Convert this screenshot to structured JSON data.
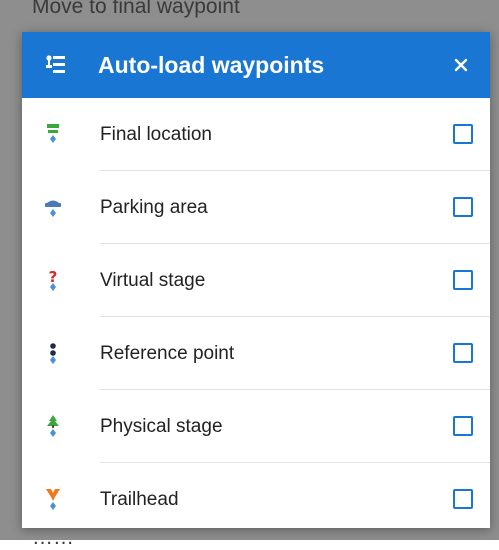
{
  "background": {
    "top_text": "Move to final waypoint",
    "bottom_text": "……"
  },
  "dialog": {
    "title": "Auto-load waypoints",
    "header_icon": "waypoint-list-icon",
    "close_icon": "close-icon",
    "accent_color": "#1976d2",
    "items": [
      {
        "label": "Final location",
        "icon": "final-location-icon",
        "checked": false
      },
      {
        "label": "Parking area",
        "icon": "parking-area-icon",
        "checked": false
      },
      {
        "label": "Virtual stage",
        "icon": "virtual-stage-icon",
        "checked": false
      },
      {
        "label": "Reference point",
        "icon": "reference-point-icon",
        "checked": false
      },
      {
        "label": "Physical stage",
        "icon": "physical-stage-icon",
        "checked": false
      },
      {
        "label": "Trailhead",
        "icon": "trailhead-icon",
        "checked": false
      }
    ]
  }
}
